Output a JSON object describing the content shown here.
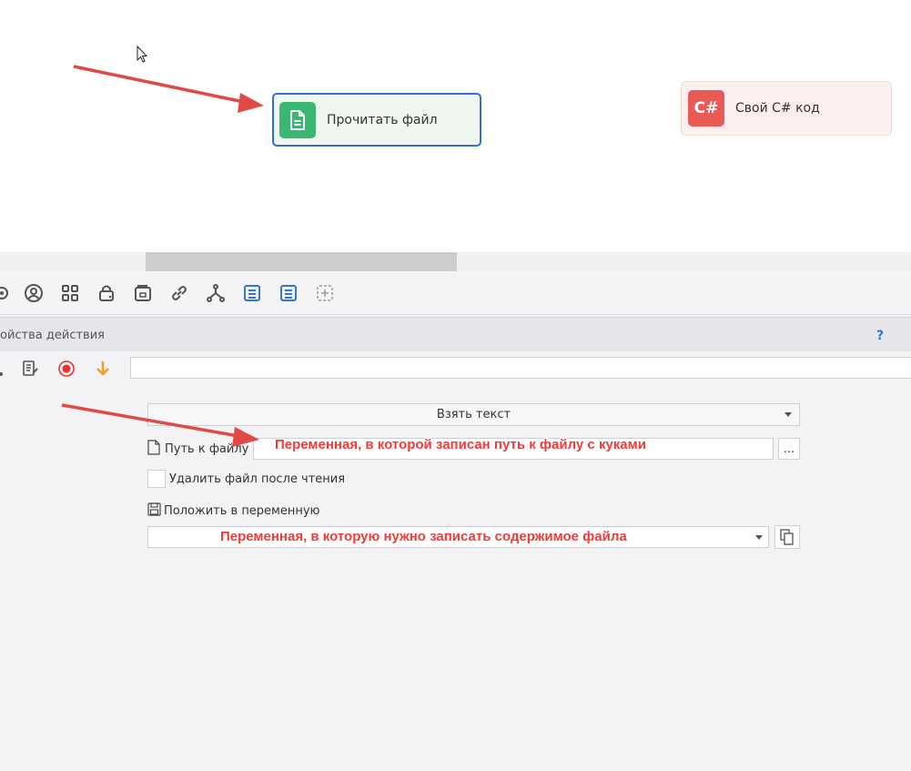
{
  "canvas": {
    "nodes": [
      {
        "label": "Прочитать файл",
        "icon": "file-document-icon",
        "color": "#3bb774",
        "selected": true
      },
      {
        "label": "Свой C# код",
        "icon_text": "C#",
        "color": "#e85a55",
        "selected": false
      }
    ]
  },
  "toolbar": {
    "icons": [
      "gear-icon",
      "user-circle-icon",
      "grid-icon",
      "lock-icon",
      "browser-tab-icon",
      "link-icon",
      "branch-icon",
      "list-icon",
      "list-icon-2",
      "add-box-icon"
    ]
  },
  "properties": {
    "title": "ойства действия",
    "help": "?",
    "action_icons": [
      "notes-icon",
      "record-icon",
      "arrow-down-icon"
    ],
    "mode_select": {
      "value": "Взять текст"
    },
    "path_label": "Путь к файлу",
    "path_button": "...",
    "delete_checkbox_label": "Удалить файл после чтения",
    "delete_checked": false,
    "save_to_var_label": "Положить в переменную"
  },
  "annotations": {
    "path": "Переменная, в которой записан путь к файлу с куками",
    "var": "Переменная, в которую нужно записать содержимое файла"
  },
  "colors": {
    "accent_blue": "#2f6fdc",
    "annotation_red": "#f23a36",
    "arrow_red": "#e04a45"
  }
}
